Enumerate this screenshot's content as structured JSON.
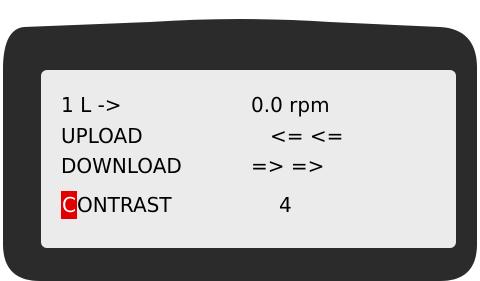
{
  "display": {
    "rows": [
      {
        "label": "1 L ->",
        "value": "0.0 rpm"
      },
      {
        "label": "UPLOAD",
        "value": "<= <="
      },
      {
        "label": "DOWNLOAD",
        "value": "=> =>"
      },
      {
        "label_cursor": "C",
        "label_rest": "ONTRAST",
        "value": "4"
      }
    ]
  },
  "colors": {
    "bezel": "#2b2b2b",
    "screen": "#ebebeb",
    "text": "#000000",
    "cursor": "#e00000"
  }
}
